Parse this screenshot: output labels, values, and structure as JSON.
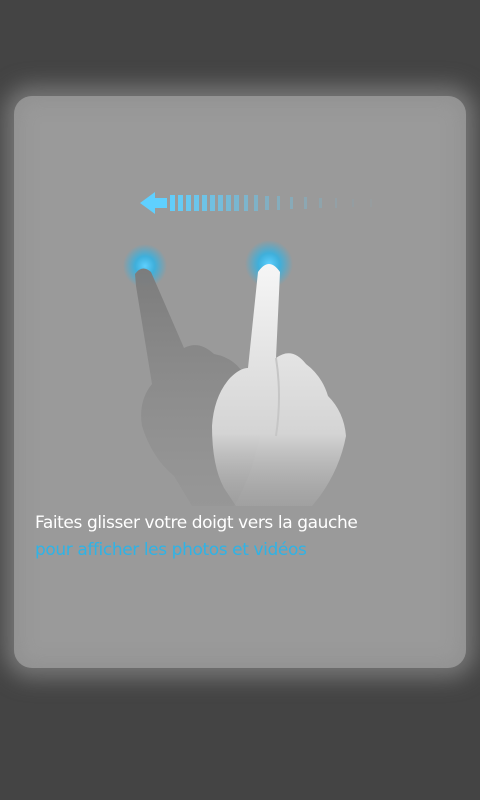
{
  "overlay": {
    "instruction_line1": "Faites glisser votre doigt vers la gauche",
    "instruction_line2": "pour afficher les photos et vidéos"
  },
  "colors": {
    "background": "#444444",
    "card": "#9a9a9a",
    "accent": "#2fb3e6",
    "text": "#ffffff"
  },
  "icons": {
    "arrow": "swipe-left-arrow-icon",
    "hand_ghost": "hand-start-position-icon",
    "hand": "hand-end-position-icon"
  }
}
